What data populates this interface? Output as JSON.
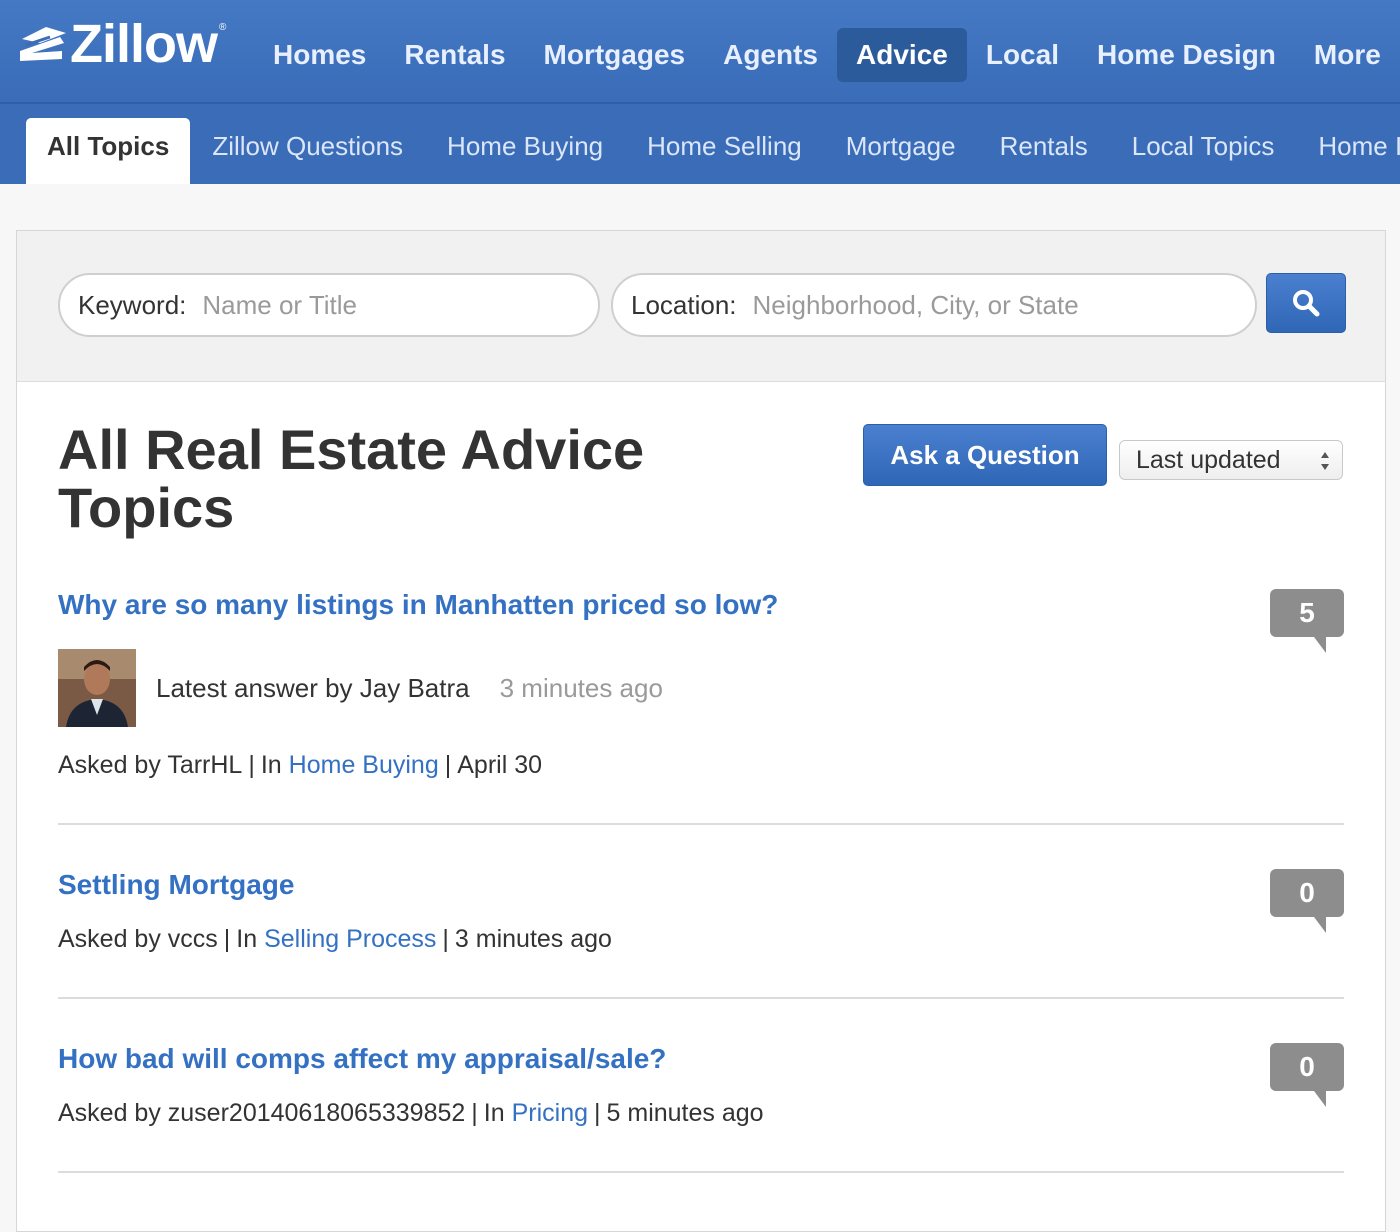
{
  "brand": {
    "name": "Zillow",
    "trademark": "®"
  },
  "main_nav": [
    {
      "label": "Homes",
      "active": false
    },
    {
      "label": "Rentals",
      "active": false
    },
    {
      "label": "Mortgages",
      "active": false
    },
    {
      "label": "Agents",
      "active": false
    },
    {
      "label": "Advice",
      "active": true
    },
    {
      "label": "Local",
      "active": false
    },
    {
      "label": "Home Design",
      "active": false
    },
    {
      "label": "More",
      "active": false
    }
  ],
  "sub_nav": [
    {
      "label": "All Topics",
      "active": true
    },
    {
      "label": "Zillow Questions",
      "active": false
    },
    {
      "label": "Home Buying",
      "active": false
    },
    {
      "label": "Home Selling",
      "active": false
    },
    {
      "label": "Mortgage",
      "active": false
    },
    {
      "label": "Rentals",
      "active": false
    },
    {
      "label": "Local Topics",
      "active": false
    },
    {
      "label": "Home Improvement",
      "active": false
    }
  ],
  "search": {
    "keyword_label": "Keyword:",
    "keyword_placeholder": "Name or Title",
    "keyword_value": "",
    "location_label": "Location:",
    "location_placeholder": "Neighborhood, City, or State",
    "location_value": "",
    "button_icon": "search-icon"
  },
  "page": {
    "title": "All Real Estate Advice Topics",
    "ask_button": "Ask a Question",
    "sort_selected": "Last updated"
  },
  "questions": [
    {
      "title": "Why are so many listings in Manhatten priced so low?",
      "answer_count": "5",
      "latest_answer": {
        "text": "Latest answer by Jay Batra",
        "time": "3 minutes ago"
      },
      "asked_by": "Asked by TarrHL",
      "in_prefix": "In",
      "category": "Home Buying",
      "date": "April 30"
    },
    {
      "title": "Settling Mortgage",
      "answer_count": "0",
      "asked_by": "Asked by vccs",
      "in_prefix": "In",
      "category": "Selling Process",
      "date": "3 minutes ago"
    },
    {
      "title": "How bad will comps affect my appraisal/sale?",
      "answer_count": "0",
      "asked_by": "Asked by zuser20140618065339852",
      "in_prefix": "In",
      "category": "Pricing",
      "date": "5 minutes ago"
    }
  ],
  "colors": {
    "nav_blue": "#3a6cb8",
    "link_blue": "#3471c2",
    "button_blue": "#2f66b5",
    "bubble_gray": "#8d8d8d"
  }
}
